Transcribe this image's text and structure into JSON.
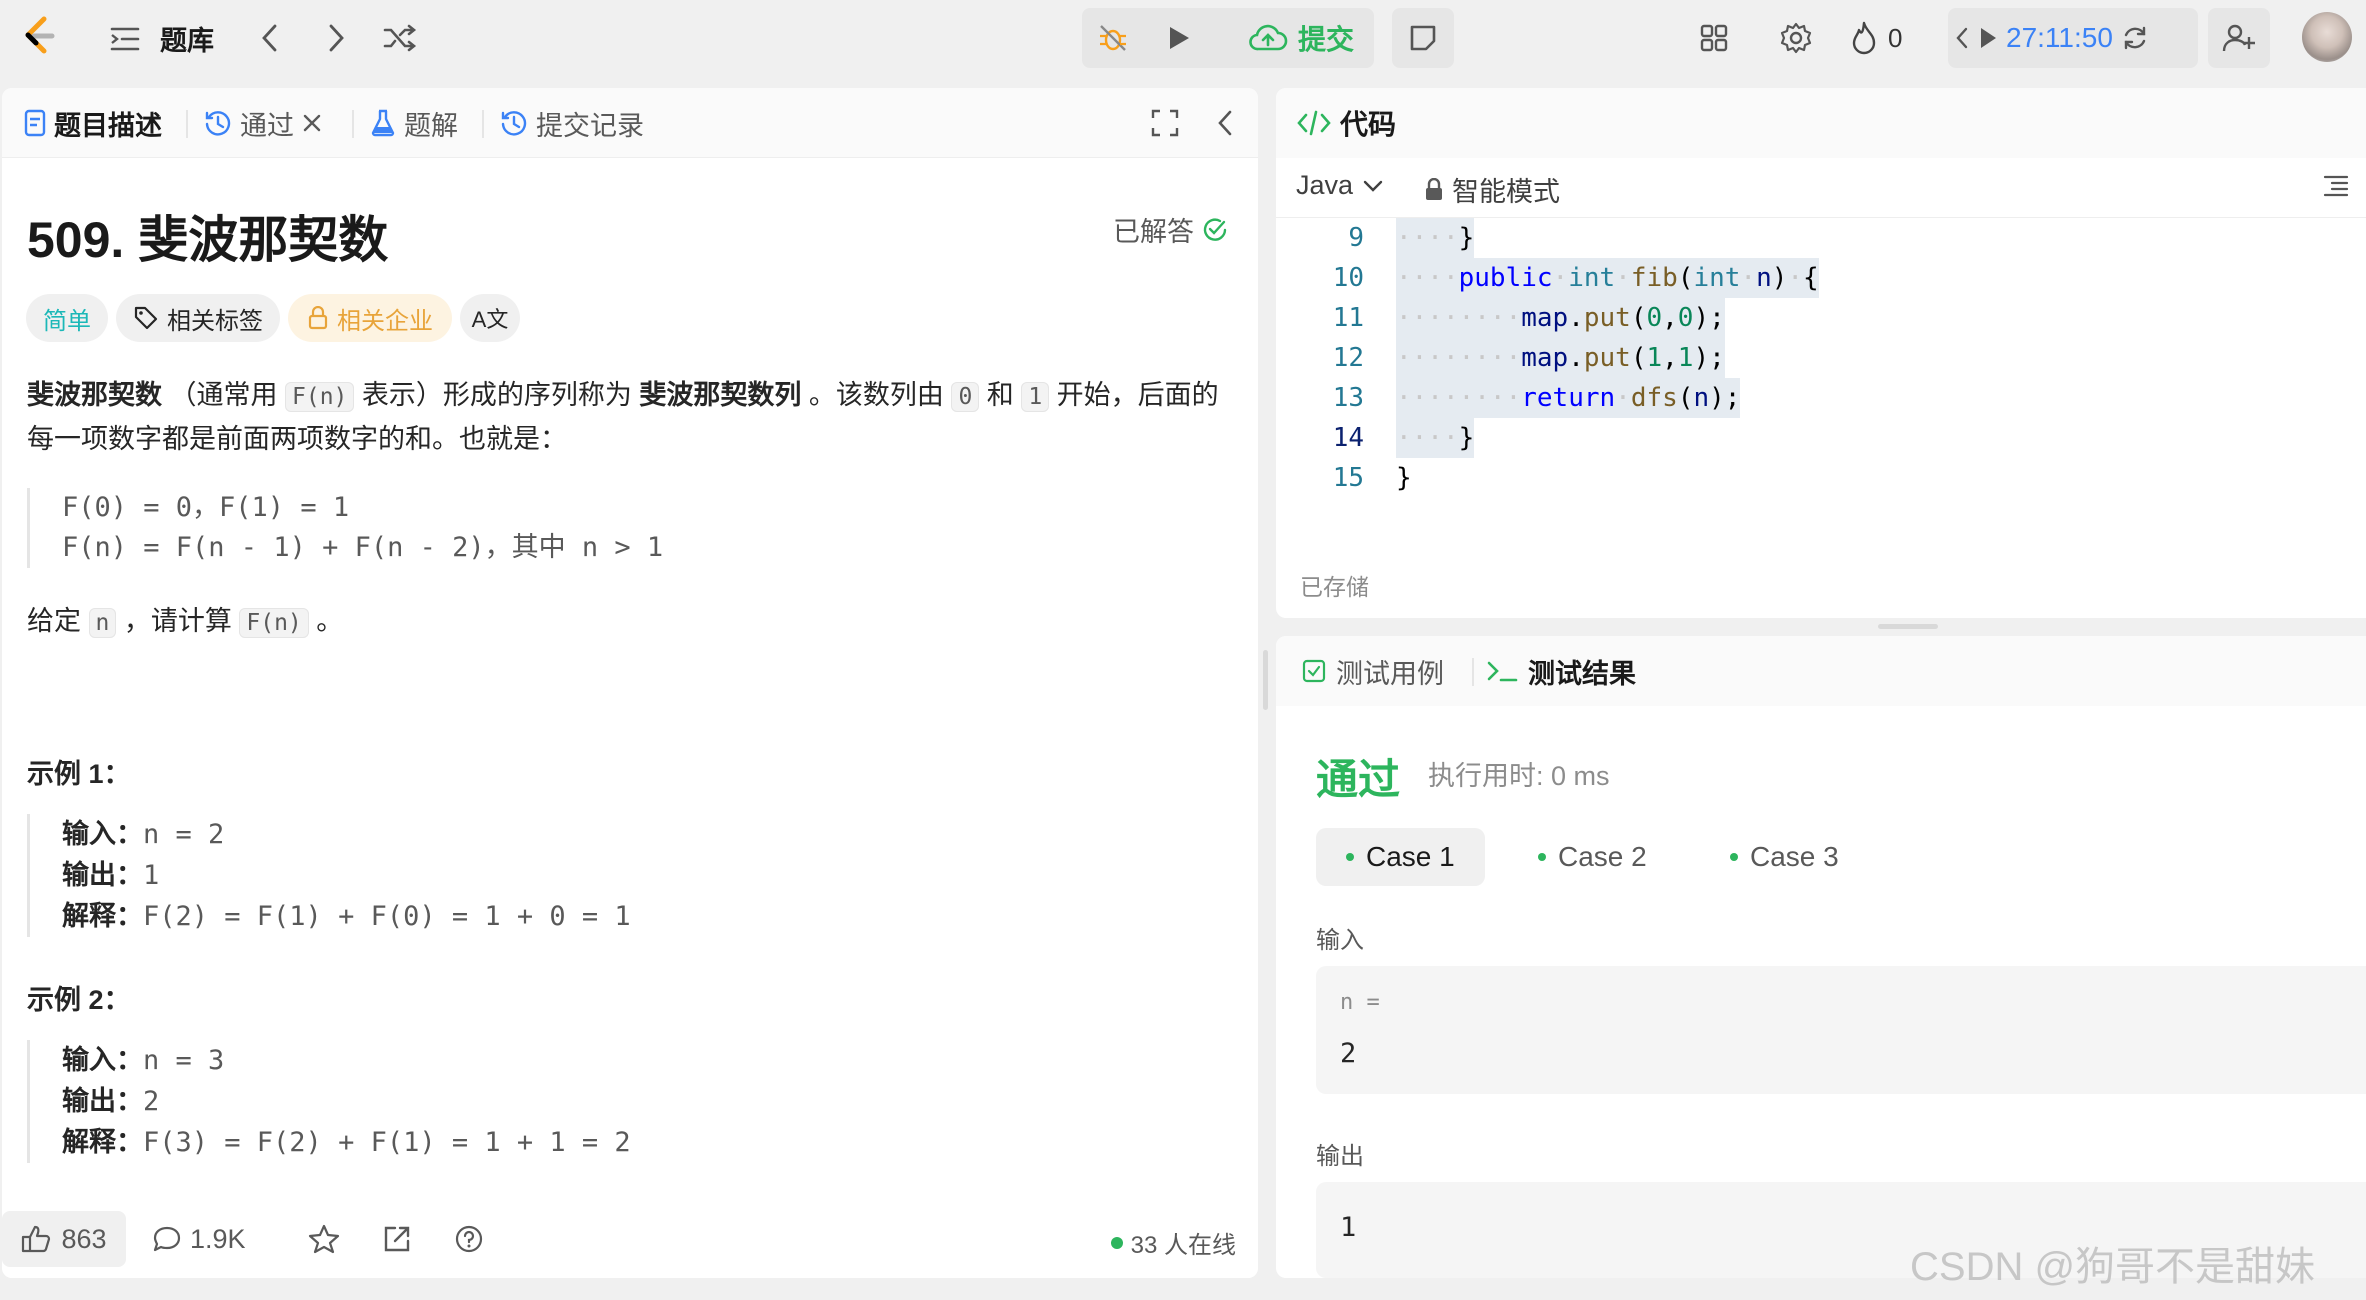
{
  "topbar": {
    "problem_bank_label": "题库",
    "submit_label": "提交",
    "fire_count": "0",
    "timer": "27:11:50",
    "icons": [
      "logo-icon",
      "list-icon",
      "chevron-left-icon",
      "chevron-right-icon",
      "shuffle-icon",
      "debug-icon",
      "play-icon",
      "upload-cloud-icon",
      "note-icon",
      "layout-icon",
      "gear-icon",
      "fire-icon",
      "refresh-icon",
      "add-user-icon"
    ]
  },
  "left": {
    "tabs": [
      {
        "label": "题目描述",
        "icon": "document-icon"
      },
      {
        "label": "通过",
        "icon": "history-icon"
      },
      {
        "label": "题解",
        "icon": "flask-icon"
      },
      {
        "label": "提交记录",
        "icon": "history-icon"
      }
    ],
    "title": "509. 斐波那契数",
    "solved_label": "已解答",
    "tags": {
      "difficulty": "简单",
      "related_tags": "相关标签",
      "related_companies": "相关企业",
      "lang": "A文"
    },
    "desc": {
      "bold1": "斐波那契数",
      "t1": " （通常用 ",
      "code1": "F(n)",
      "t2": " 表示）形成的序列称为 ",
      "bold2": "斐波那契数列",
      "t3": " 。该数列由 ",
      "code2": "0",
      "t4": " 和 ",
      "code3": "1",
      "t5": " 开始，后面的每一项数字都是前面两项数字的和。也就是："
    },
    "formula": [
      "F(0) = 0，F(1) = 1",
      "F(n) = F(n - 1) + F(n - 2)，其中 n > 1"
    ],
    "given": {
      "t1": "给定 ",
      "code1": "n",
      "t2": " ，请计算 ",
      "code2": "F(n)",
      "t3": " 。"
    },
    "examples": [
      {
        "heading": "示例 1：",
        "input_label": "输入：",
        "input": "n = 2",
        "output_label": "输出：",
        "output": "1",
        "explain_label": "解释：",
        "explain": "F(2) = F(1) + F(0) = 1 + 0 = 1"
      },
      {
        "heading": "示例 2：",
        "input_label": "输入：",
        "input": "n = 3",
        "output_label": "输出：",
        "output": "2",
        "explain_label": "解释：",
        "explain": "F(3) = F(2) + F(1) = 1 + 1 = 2"
      }
    ],
    "bottom": {
      "likes": "863",
      "comments": "1.9K",
      "online": "33 人在线"
    }
  },
  "code": {
    "header": "代码",
    "language": "Java",
    "mode": "智能模式",
    "line_numbers": [
      "9",
      "10",
      "11",
      "12",
      "13",
      "14",
      "15"
    ],
    "saved": "已存储"
  },
  "test": {
    "tab_cases": "测试用例",
    "tab_results": "测试结果",
    "status": "通过",
    "runtime": "执行用时: 0 ms",
    "cases": [
      "Case 1",
      "Case 2",
      "Case 3"
    ],
    "input_label": "输入",
    "input_var": "n =",
    "input_value": "2",
    "output_label": "输出",
    "output_value": "1"
  },
  "watermark": "CSDN @狗哥不是甜妹",
  "colors": {
    "accent_green": "#2db55d",
    "timer_blue": "#3b82f6",
    "company_orange": "#e8a43a",
    "easy_teal": "#1cb8b8"
  }
}
